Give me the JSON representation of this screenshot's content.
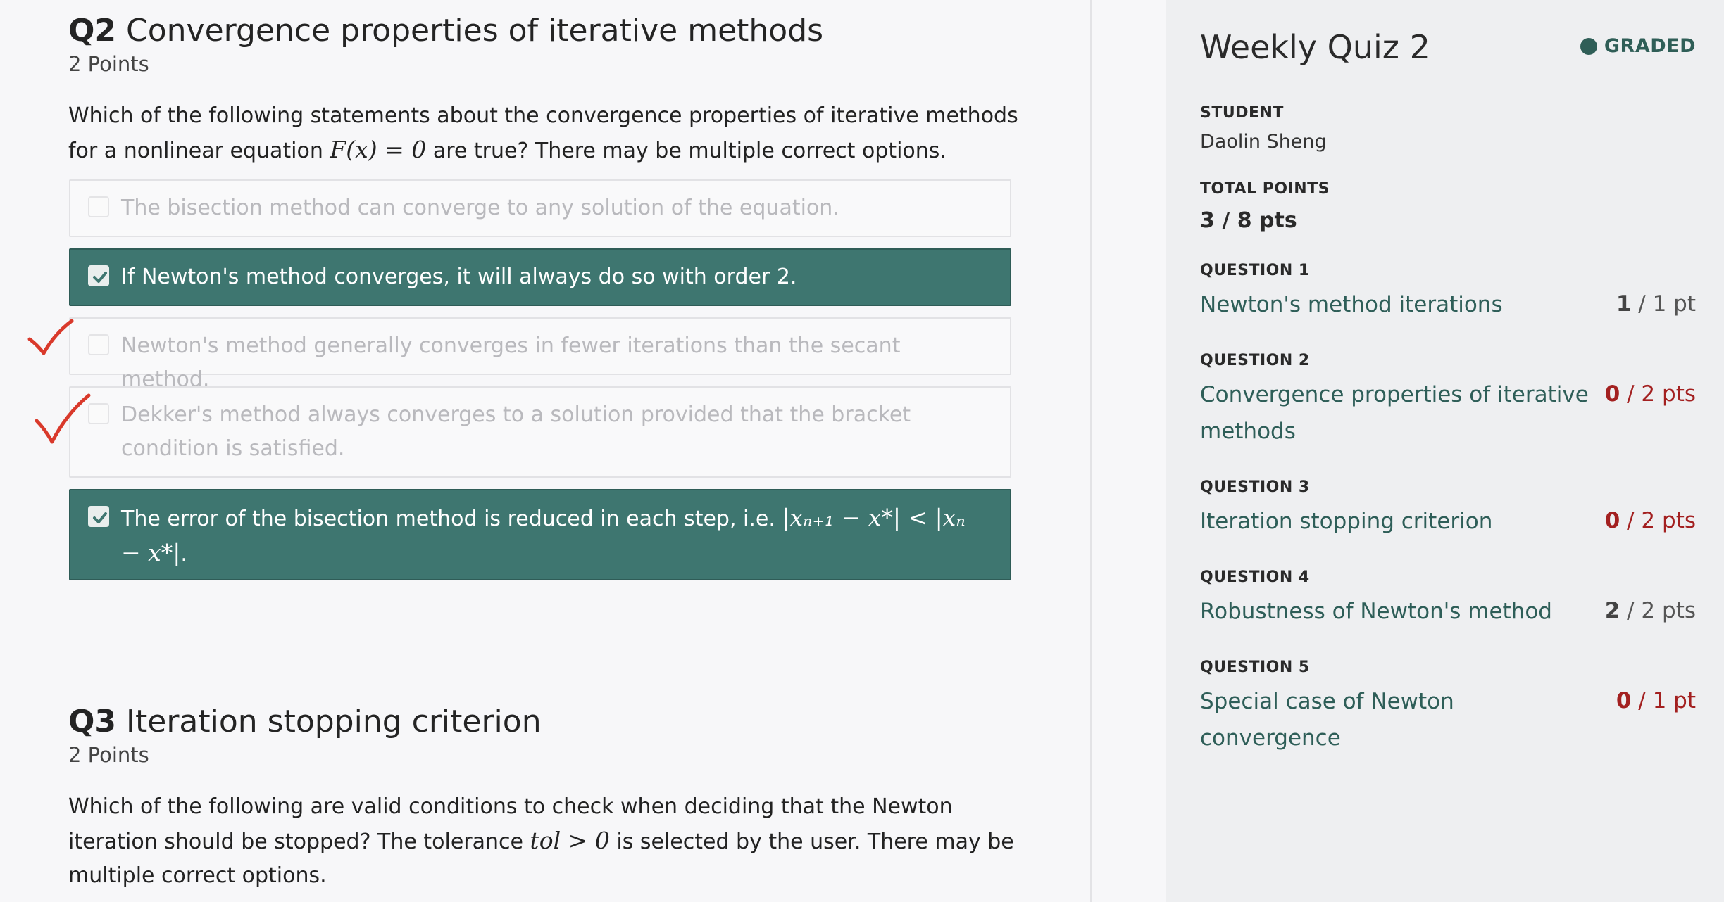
{
  "q2": {
    "num": "Q2",
    "title": "Convergence properties of iterative methods",
    "points": "2 Points",
    "text_a": "Which of the following statements about the convergence properties of iterative methods for a nonlinear equation",
    "math_eq": "F(x) = 0",
    "text_b": "are true? There may be multiple correct options.",
    "options": [
      {
        "label": "The bisection method can converge to any solution of the equation.",
        "checked": false
      },
      {
        "label": "If Newton's method converges, it will always do so with order 2.",
        "checked": true
      },
      {
        "label": "Newton's method generally converges in fewer iterations than the secant method.",
        "checked": false
      },
      {
        "label": "Dekker's method always converges to a solution provided that the bracket condition is satisfied.",
        "checked": false
      },
      {
        "label_a": "The error of the bisection method is reduced in each step, i.e.",
        "label_math": "|xₙ₊₁ − x*| < |xₙ − x*|",
        "label_b": ".",
        "checked": true
      }
    ]
  },
  "q3": {
    "num": "Q3",
    "title": "Iteration stopping criterion",
    "points": "2 Points",
    "text_a": "Which of the following are valid conditions to check when deciding that the Newton iteration should be stopped? The tolerance",
    "math_tol": "tol > 0",
    "text_b": "is selected by the user. There may be multiple correct options."
  },
  "sidebar": {
    "title": "Weekly Quiz 2",
    "status": "GRADED",
    "student_label": "STUDENT",
    "student_name": "Daolin Sheng",
    "total_label": "TOTAL POINTS",
    "total_value": "3 / 8 pts",
    "questions": [
      {
        "label": "QUESTION 1",
        "name": "Newton's method iterations",
        "earned": "1",
        "rest": " / 1 pt"
      },
      {
        "label": "QUESTION 2",
        "name": "Convergence properties of iterative methods",
        "earned": "0",
        "rest": " / 2 pts"
      },
      {
        "label": "QUESTION 3",
        "name": "Iteration stopping criterion",
        "earned": "0",
        "rest": " / 2 pts"
      },
      {
        "label": "QUESTION 4",
        "name": "Robustness of Newton's method",
        "earned": "2",
        "rest": " / 2 pts"
      },
      {
        "label": "QUESTION 5",
        "name": "Special case of Newton convergence",
        "earned": "0",
        "rest": " / 1 pt"
      }
    ]
  },
  "colors": {
    "accent": "#3e7670",
    "selected_border": "#2f5c57",
    "link": "#2e5e58",
    "error": "#a32020",
    "tick": "#d9392b"
  },
  "icons": [
    "checkbox-checked-icon",
    "checkbox-empty-icon",
    "red-checkmark-icon",
    "status-dot-icon"
  ]
}
